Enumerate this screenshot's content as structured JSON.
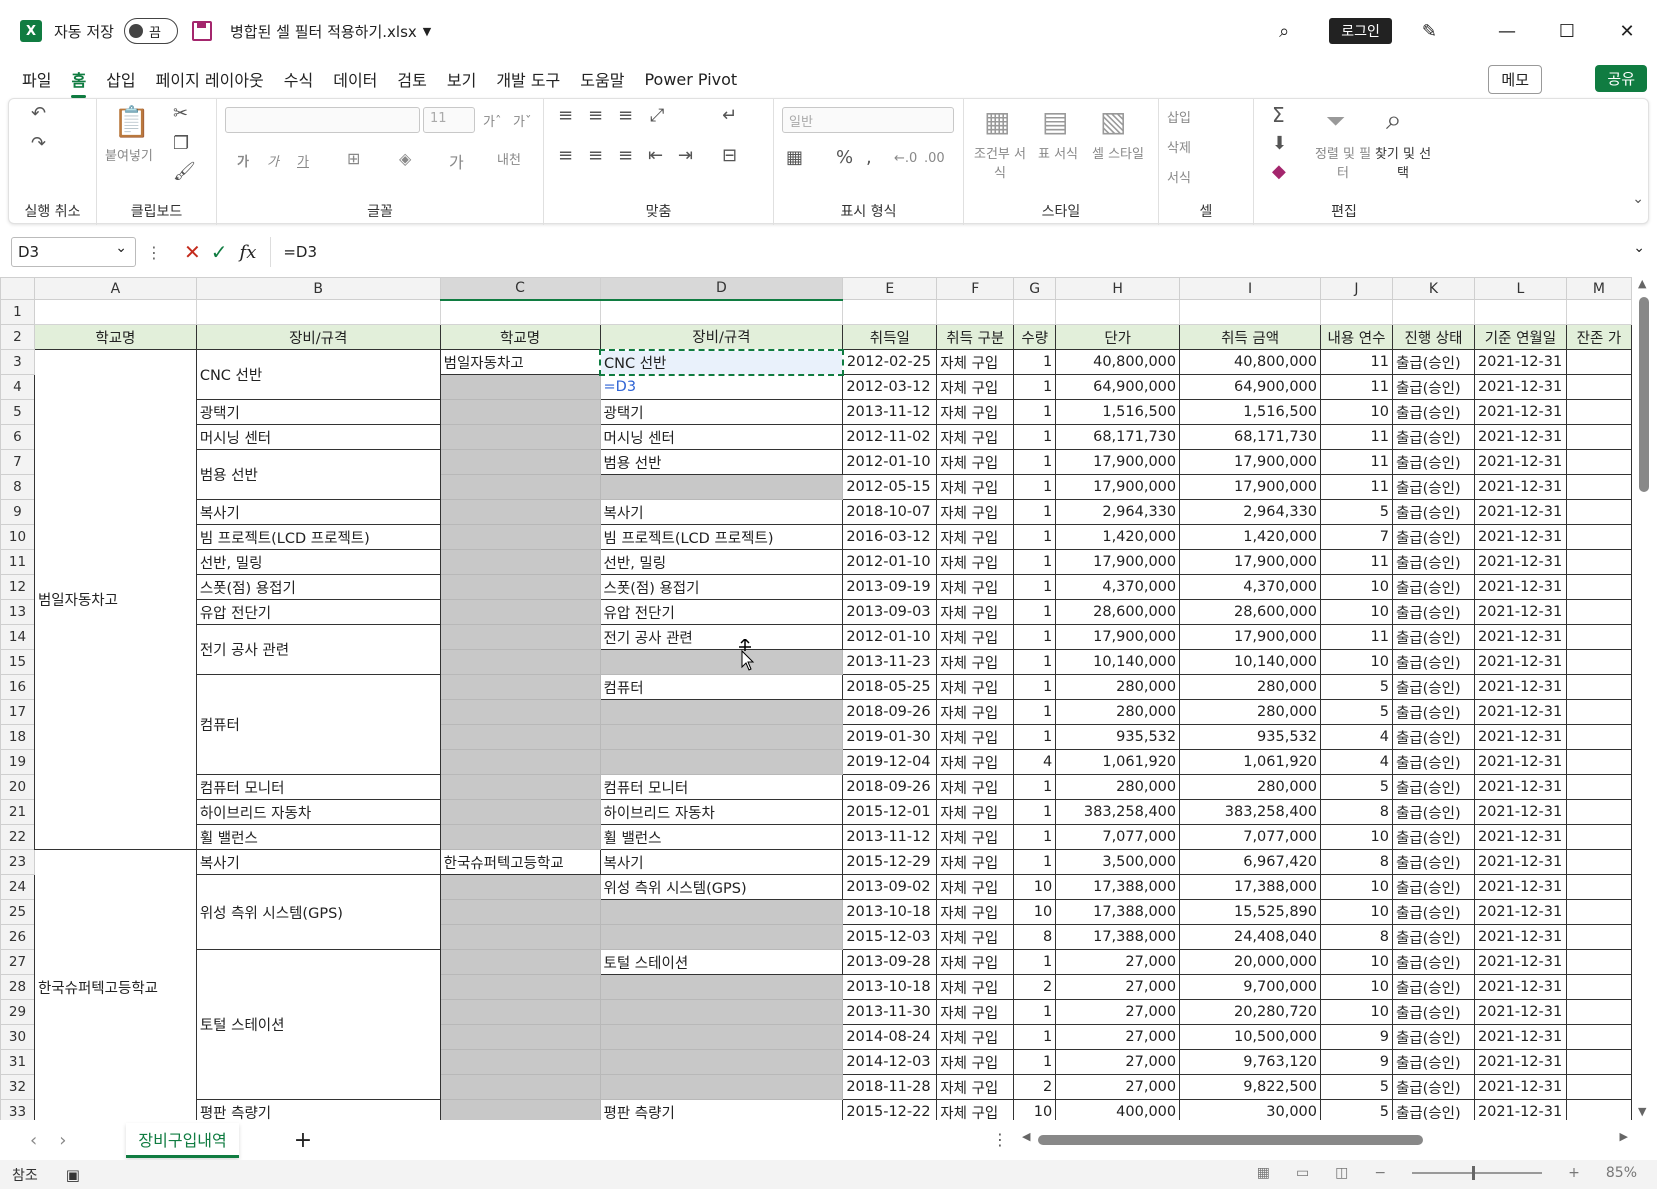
{
  "titlebar": {
    "logo": "X",
    "autosave_label": "자동 저장",
    "autosave_state": "끔",
    "filename": "병합된 셀 필터 적용하기.xlsx",
    "login": "로그인",
    "min": "—",
    "max": "☐",
    "close": "✕"
  },
  "menu": {
    "tabs": [
      "파일",
      "홈",
      "삽입",
      "페이지 레이아웃",
      "수식",
      "데이터",
      "검토",
      "보기",
      "개발 도구",
      "도움말",
      "Power Pivot"
    ],
    "active": "홈",
    "memo": "메모",
    "share": "공유"
  },
  "ribbon": {
    "undo_label": "실행 취소",
    "clipboard_label": "클립보드",
    "paste_label": "붙여넣기",
    "font_label": "글꼴",
    "font_size": "11",
    "align_label": "맞춤",
    "number_label": "표시 형식",
    "number_format": "일반",
    "style_label": "스타일",
    "cond_format": "조건부 서식",
    "table_format": "표 서식",
    "cell_style": "셀 스타일",
    "cells_label": "셀",
    "insert": "삽입",
    "delete": "삭제",
    "format": "서식",
    "edit_label": "편집",
    "sort_filter": "정렬 및 필터",
    "find_select": "찾기 및 선택"
  },
  "formulabar": {
    "namebox": "D3",
    "formula": "=D3",
    "cancel": "✕",
    "enter": "✓",
    "fx": "fx"
  },
  "columns": [
    "A",
    "B",
    "C",
    "D",
    "E",
    "F",
    "G",
    "H",
    "I",
    "J",
    "K",
    "L",
    "M"
  ],
  "headers": {
    "a": "학교명",
    "b": "장비/규격",
    "c": "학교명",
    "d": "장비/규격",
    "e": "취득일",
    "f": "취득 구분",
    "g": "수량",
    "h": "단가",
    "i": "취득 금액",
    "j": "내용 연수",
    "k": "진행 상태",
    "l": "기준 연월일",
    "m": "잔존 가"
  },
  "merged": {
    "a1": "범일자동차고",
    "a2": "한국슈퍼텍고등학교",
    "c1": "범일자동차고",
    "c2": "한국슈퍼텍고등학교"
  },
  "bvalues": [
    "CNC 선반",
    "광택기",
    "머시닝 센터",
    "범용 선반",
    "복사기",
    "빔 프로젝트(LCD 프로젝트)",
    "선반, 밀링",
    "스폿(점) 용접기",
    "유압 전단기",
    "전기 공사 관련",
    "컴퓨터",
    "컴퓨터 모니터",
    "하이브리드 자동차",
    "휠 밸런스",
    "복사기",
    "위성 측위 시스템(GPS)",
    "토털 스테이션",
    "평판 측량기"
  ],
  "dvalues": {
    "r3": "CNC 선반",
    "r4": "=D3",
    "r5": "광택기",
    "r6": "머시닝 센터",
    "r7": "범용 선반",
    "r9": "복사기",
    "r10": "빔 프로젝트(LCD 프로젝트)",
    "r11": "선반, 밀링",
    "r12": "스폿(점) 용접기",
    "r13": "유압 전단기",
    "r14": "전기 공사 관련",
    "r16": "컴퓨터",
    "r20": "컴퓨터 모니터",
    "r21": "하이브리드 자동차",
    "r22": "휠 밸런스",
    "r23": "복사기",
    "r24": "위성 측위 시스템(GPS)",
    "r27": "토털 스테이션",
    "r33": "평판 측량기"
  },
  "rows": [
    {
      "n": "3",
      "e": "2012-02-25",
      "f": "자체 구입",
      "g": "1",
      "h": "40,800,000",
      "i": "40,800,000",
      "j": "11",
      "k": "출급(승인)",
      "l": "2021-12-31"
    },
    {
      "n": "4",
      "e": "2012-03-12",
      "f": "자체 구입",
      "g": "1",
      "h": "64,900,000",
      "i": "64,900,000",
      "j": "11",
      "k": "출급(승인)",
      "l": "2021-12-31"
    },
    {
      "n": "5",
      "e": "2013-11-12",
      "f": "자체 구입",
      "g": "1",
      "h": "1,516,500",
      "i": "1,516,500",
      "j": "10",
      "k": "출급(승인)",
      "l": "2021-12-31"
    },
    {
      "n": "6",
      "e": "2012-11-02",
      "f": "자체 구입",
      "g": "1",
      "h": "68,171,730",
      "i": "68,171,730",
      "j": "11",
      "k": "출급(승인)",
      "l": "2021-12-31"
    },
    {
      "n": "7",
      "e": "2012-01-10",
      "f": "자체 구입",
      "g": "1",
      "h": "17,900,000",
      "i": "17,900,000",
      "j": "11",
      "k": "출급(승인)",
      "l": "2021-12-31"
    },
    {
      "n": "8",
      "e": "2012-05-15",
      "f": "자체 구입",
      "g": "1",
      "h": "17,900,000",
      "i": "17,900,000",
      "j": "11",
      "k": "출급(승인)",
      "l": "2021-12-31"
    },
    {
      "n": "9",
      "e": "2018-10-07",
      "f": "자체 구입",
      "g": "1",
      "h": "2,964,330",
      "i": "2,964,330",
      "j": "5",
      "k": "출급(승인)",
      "l": "2021-12-31"
    },
    {
      "n": "10",
      "e": "2016-03-12",
      "f": "자체 구입",
      "g": "1",
      "h": "1,420,000",
      "i": "1,420,000",
      "j": "7",
      "k": "출급(승인)",
      "l": "2021-12-31"
    },
    {
      "n": "11",
      "e": "2012-01-10",
      "f": "자체 구입",
      "g": "1",
      "h": "17,900,000",
      "i": "17,900,000",
      "j": "11",
      "k": "출급(승인)",
      "l": "2021-12-31"
    },
    {
      "n": "12",
      "e": "2013-09-19",
      "f": "자체 구입",
      "g": "1",
      "h": "4,370,000",
      "i": "4,370,000",
      "j": "10",
      "k": "출급(승인)",
      "l": "2021-12-31"
    },
    {
      "n": "13",
      "e": "2013-09-03",
      "f": "자체 구입",
      "g": "1",
      "h": "28,600,000",
      "i": "28,600,000",
      "j": "10",
      "k": "출급(승인)",
      "l": "2021-12-31"
    },
    {
      "n": "14",
      "e": "2012-01-10",
      "f": "자체 구입",
      "g": "1",
      "h": "17,900,000",
      "i": "17,900,000",
      "j": "11",
      "k": "출급(승인)",
      "l": "2021-12-31"
    },
    {
      "n": "15",
      "e": "2013-11-23",
      "f": "자체 구입",
      "g": "1",
      "h": "10,140,000",
      "i": "10,140,000",
      "j": "10",
      "k": "출급(승인)",
      "l": "2021-12-31"
    },
    {
      "n": "16",
      "e": "2018-05-25",
      "f": "자체 구입",
      "g": "1",
      "h": "280,000",
      "i": "280,000",
      "j": "5",
      "k": "출급(승인)",
      "l": "2021-12-31"
    },
    {
      "n": "17",
      "e": "2018-09-26",
      "f": "자체 구입",
      "g": "1",
      "h": "280,000",
      "i": "280,000",
      "j": "5",
      "k": "출급(승인)",
      "l": "2021-12-31"
    },
    {
      "n": "18",
      "e": "2019-01-30",
      "f": "자체 구입",
      "g": "1",
      "h": "935,532",
      "i": "935,532",
      "j": "4",
      "k": "출급(승인)",
      "l": "2021-12-31"
    },
    {
      "n": "19",
      "e": "2019-12-04",
      "f": "자체 구입",
      "g": "4",
      "h": "1,061,920",
      "i": "1,061,920",
      "j": "4",
      "k": "출급(승인)",
      "l": "2021-12-31"
    },
    {
      "n": "20",
      "e": "2018-09-26",
      "f": "자체 구입",
      "g": "1",
      "h": "280,000",
      "i": "280,000",
      "j": "5",
      "k": "출급(승인)",
      "l": "2021-12-31"
    },
    {
      "n": "21",
      "e": "2015-12-01",
      "f": "자체 구입",
      "g": "1",
      "h": "383,258,400",
      "i": "383,258,400",
      "j": "8",
      "k": "출급(승인)",
      "l": "2021-12-31"
    },
    {
      "n": "22",
      "e": "2013-11-12",
      "f": "자체 구입",
      "g": "1",
      "h": "7,077,000",
      "i": "7,077,000",
      "j": "10",
      "k": "출급(승인)",
      "l": "2021-12-31"
    },
    {
      "n": "23",
      "e": "2015-12-29",
      "f": "자체 구입",
      "g": "1",
      "h": "3,500,000",
      "i": "6,967,420",
      "j": "8",
      "k": "출급(승인)",
      "l": "2021-12-31"
    },
    {
      "n": "24",
      "e": "2013-09-02",
      "f": "자체 구입",
      "g": "10",
      "h": "17,388,000",
      "i": "17,388,000",
      "j": "10",
      "k": "출급(승인)",
      "l": "2021-12-31"
    },
    {
      "n": "25",
      "e": "2013-10-18",
      "f": "자체 구입",
      "g": "10",
      "h": "17,388,000",
      "i": "15,525,890",
      "j": "10",
      "k": "출급(승인)",
      "l": "2021-12-31"
    },
    {
      "n": "26",
      "e": "2015-12-03",
      "f": "자체 구입",
      "g": "8",
      "h": "17,388,000",
      "i": "24,408,040",
      "j": "8",
      "k": "출급(승인)",
      "l": "2021-12-31"
    },
    {
      "n": "27",
      "e": "2013-09-28",
      "f": "자체 구입",
      "g": "1",
      "h": "27,000",
      "i": "20,000,000",
      "j": "10",
      "k": "출급(승인)",
      "l": "2021-12-31"
    },
    {
      "n": "28",
      "e": "2013-10-18",
      "f": "자체 구입",
      "g": "2",
      "h": "27,000",
      "i": "9,700,000",
      "j": "10",
      "k": "출급(승인)",
      "l": "2021-12-31"
    },
    {
      "n": "29",
      "e": "2013-11-30",
      "f": "자체 구입",
      "g": "1",
      "h": "27,000",
      "i": "20,280,720",
      "j": "10",
      "k": "출급(승인)",
      "l": "2021-12-31"
    },
    {
      "n": "30",
      "e": "2014-08-24",
      "f": "자체 구입",
      "g": "1",
      "h": "27,000",
      "i": "10,500,000",
      "j": "9",
      "k": "출급(승인)",
      "l": "2021-12-31"
    },
    {
      "n": "31",
      "e": "2014-12-03",
      "f": "자체 구입",
      "g": "1",
      "h": "27,000",
      "i": "9,763,120",
      "j": "9",
      "k": "출급(승인)",
      "l": "2021-12-31"
    },
    {
      "n": "32",
      "e": "2018-11-28",
      "f": "자체 구입",
      "g": "2",
      "h": "27,000",
      "i": "9,822,500",
      "j": "5",
      "k": "출급(승인)",
      "l": "2021-12-31"
    },
    {
      "n": "33",
      "e": "2015-12-22",
      "f": "자체 구입",
      "g": "10",
      "h": "400,000",
      "i": "30,000",
      "j": "5",
      "k": "출급(승인)",
      "l": "2021-12-31"
    }
  ],
  "sheet": {
    "tab": "장비구입내역",
    "add": "+",
    "prev": "‹",
    "next": "›"
  },
  "status": {
    "mode": "참조",
    "zoom": "85%"
  }
}
